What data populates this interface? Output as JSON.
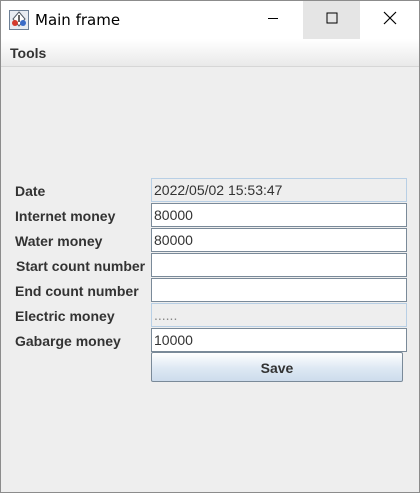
{
  "window": {
    "title": "Main frame",
    "controls": {
      "minimize": "minimize-icon",
      "maximize": "maximize-icon",
      "close": "close-icon"
    }
  },
  "menubar": {
    "items": [
      {
        "label": "Tools"
      }
    ]
  },
  "form": {
    "fields": [
      {
        "label": "Date",
        "value": "2022/05/02 15:53:47",
        "editable": false
      },
      {
        "label": "Internet money",
        "value": "80000",
        "editable": true
      },
      {
        "label": "Water money",
        "value": "80000",
        "editable": true
      },
      {
        "label": "Start count number",
        "value": "",
        "editable": true
      },
      {
        "label": "End count number",
        "value": "",
        "editable": true
      },
      {
        "label": "Electric money",
        "value": "......",
        "editable": false
      },
      {
        "label": "Gabarge money",
        "value": "10000",
        "editable": true
      }
    ],
    "save_label": "Save"
  },
  "colors": {
    "window_background": "#eeeeee",
    "field_border": "#7a8a99",
    "readonly_field_border": "#b8cfe5",
    "button_gradient_end": "#cddcec"
  }
}
